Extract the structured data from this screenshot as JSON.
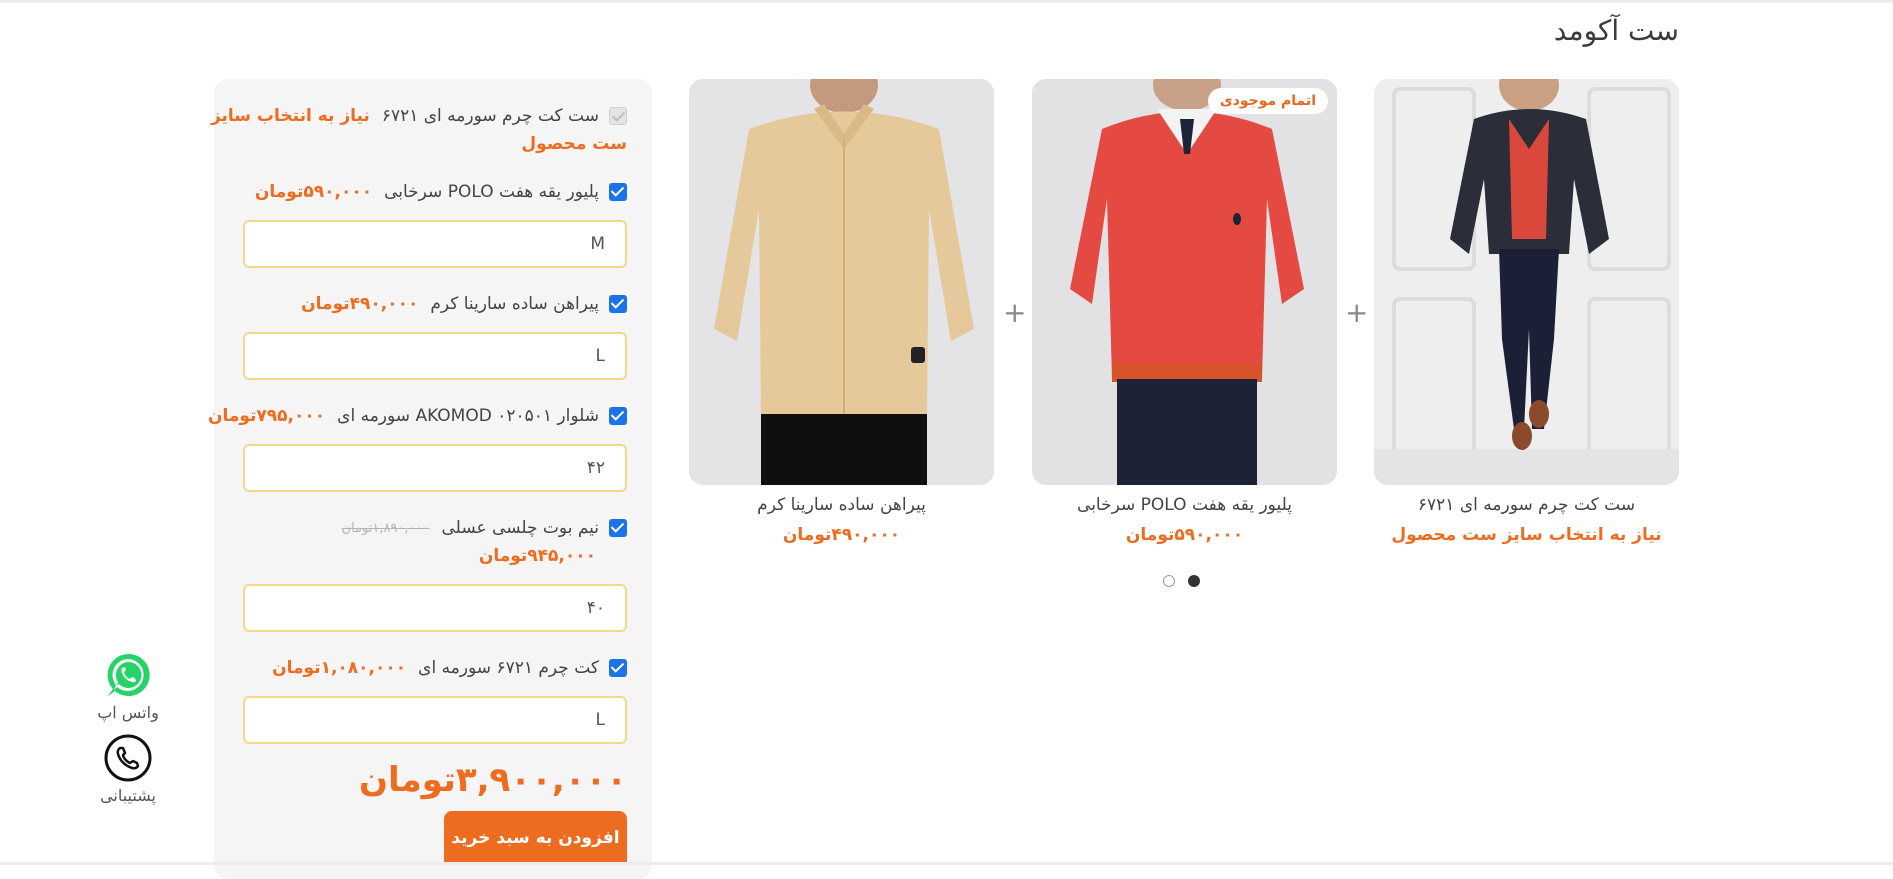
{
  "section": {
    "title": "ست آکومد"
  },
  "products": [
    {
      "name": "ست کت چرم سورمه ای ۶۷۲۱",
      "price": "نیاز به انتخاب سایز ست محصول",
      "badge": ""
    },
    {
      "name": "پلیور یقه هفت POLO سرخابی",
      "price": "۵۹۰,۰۰۰تومان",
      "badge": "اتمام موجودی"
    },
    {
      "name": "پیراهن ساده سارینا کرم",
      "price": "۴۹۰,۰۰۰تومان",
      "badge": ""
    }
  ],
  "carousel": {
    "pages": 2,
    "active": 1
  },
  "panel": {
    "items": [
      {
        "label": "ست کت چرم سورمه ای ۶۷۲۱",
        "price": "نیاز به انتخاب سایز",
        "price_line2": "ست محصول",
        "old_price": "",
        "size": ""
      },
      {
        "label": "پلیور یقه هفت POLO سرخابی",
        "price": "۵۹۰,۰۰۰تومان",
        "old_price": "",
        "size": "M"
      },
      {
        "label": "پیراهن ساده سارینا کرم",
        "price": "۴۹۰,۰۰۰تومان",
        "old_price": "",
        "size": "L"
      },
      {
        "label": "شلوار AKOMOD ۰۲۰۵۰۱ سورمه ای",
        "price": "۷۹۵,۰۰۰تومان",
        "old_price": "",
        "size": "۴۲"
      },
      {
        "label": "نیم بوت چلسی عسلی",
        "price": "۹۴۵,۰۰۰تومان",
        "old_price": "۱,۸۹۰,۰۰۰تومان",
        "size": "۴۰"
      },
      {
        "label": "کت چرم ۶۷۲۱ سورمه ای",
        "price": "۱,۰۸۰,۰۰۰تومان",
        "old_price": "",
        "size": "L"
      }
    ],
    "total": "۳,۹۰۰,۰۰۰تومان",
    "add_to_cart": "افزودن به سبد خرید"
  },
  "contact": {
    "whatsapp_label": "واتس اپ",
    "support_label": "پشتیبانی"
  },
  "colors": {
    "accent": "#ee6c1f",
    "checkbox": "#1a73e8",
    "size_border": "#f8d78a",
    "panel_bg": "#f5f5f5"
  }
}
